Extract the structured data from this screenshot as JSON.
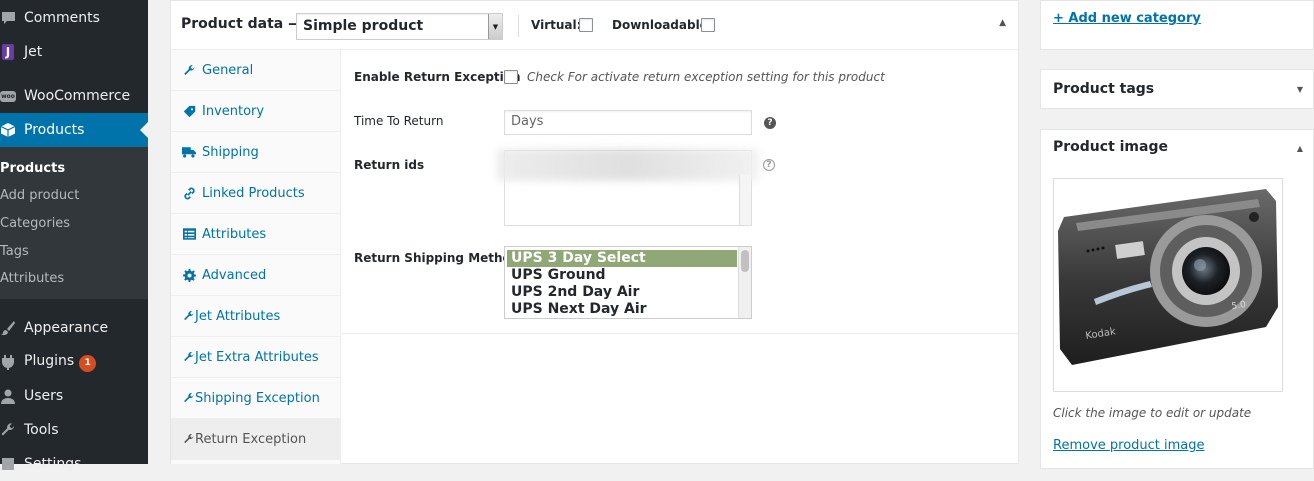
{
  "sidebar": {
    "items": [
      {
        "label": "Comments",
        "icon": "comment-icon"
      },
      {
        "label": "Jet",
        "icon": "jet-icon"
      },
      {
        "label": "WooCommerce",
        "icon": "woo-icon"
      },
      {
        "label": "Products",
        "icon": "box-icon"
      },
      {
        "label": "Appearance",
        "icon": "paintbrush-icon"
      },
      {
        "label": "Plugins",
        "icon": "plug-icon",
        "badge": "1"
      },
      {
        "label": "Users",
        "icon": "user-icon"
      },
      {
        "label": "Tools",
        "icon": "wrench-icon"
      },
      {
        "label": "Settings",
        "icon": "settings-icon"
      }
    ],
    "submenu": [
      "Products",
      "Add product",
      "Categories",
      "Tags",
      "Attributes"
    ]
  },
  "product_data": {
    "title": "Product data —",
    "type_value": "Simple product",
    "virtual_label": "Virtual:",
    "downloadable_label": "Downloadable:",
    "tabs": [
      {
        "label": "General",
        "icon": "wrench-icon"
      },
      {
        "label": "Inventory",
        "icon": "tag-icon"
      },
      {
        "label": "Shipping",
        "icon": "truck-icon"
      },
      {
        "label": "Linked Products",
        "icon": "link-icon"
      },
      {
        "label": "Attributes",
        "icon": "table-icon"
      },
      {
        "label": "Advanced",
        "icon": "gear-icon"
      },
      {
        "label": "Jet Attributes",
        "icon": "wrench-icon"
      },
      {
        "label": "Jet Extra Attributes",
        "icon": "wrench-icon"
      },
      {
        "label": "Shipping Exception",
        "icon": "wrench-icon"
      },
      {
        "label": "Return Exception",
        "icon": "wrench-icon"
      }
    ],
    "panel": {
      "enable_label": "Enable Return Exception",
      "enable_desc": "Check For activate return exception setting for this product",
      "time_label": "Time To Return",
      "time_placeholder": "Days",
      "return_ids_label": "Return ids",
      "shipping_label": "Return Shipping Method",
      "shipping_options": [
        "UPS 3 Day Select",
        "UPS Ground",
        "UPS 2nd Day Air",
        "UPS Next Day Air"
      ]
    }
  },
  "right_column": {
    "add_category_link": "+ Add new category",
    "tags_title": "Product tags",
    "image_title": "Product image",
    "image_caption": "Click the image to edit or update",
    "remove_image_link": "Remove product image"
  },
  "colors": {
    "sidebar_bg": "#23282d",
    "accent": "#0073aa",
    "selected_option": "#8fa876",
    "badge": "#d54e21"
  }
}
